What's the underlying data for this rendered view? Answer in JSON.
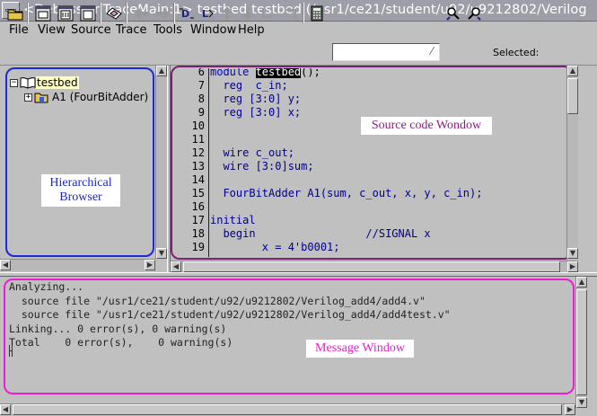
{
  "window": {
    "title": "<Debussy:nTraceMain:1> testbed testbed (/usr1/ce21/student/u92/u9212802/Verilog"
  },
  "menubar": {
    "items": [
      "File",
      "View",
      "Source",
      "Trace",
      "Tools",
      "Window",
      "Help"
    ]
  },
  "toolbar": {
    "icons": [
      "open-folder-icon",
      "schematic-view-icon",
      "waveform-view-icon",
      "state-view-icon",
      "find-icon",
      "back-arrow-icon",
      "forward-arrow-icon",
      "driver-icon",
      "load-icon",
      "up-arrow-icon",
      "down-arrow-icon",
      "trace-back-icon",
      "trace-forward-icon",
      "calculator-icon",
      "search-forward-icon",
      "search-backward-icon"
    ],
    "search_value": "",
    "selected_label": "Selected:"
  },
  "hierarchy": {
    "items": [
      {
        "label": "testbed",
        "toggle": "−",
        "selected": true
      },
      {
        "label": "A1 (FourBitAdder)",
        "toggle": "+",
        "selected": false
      }
    ]
  },
  "source": {
    "lines": [
      {
        "num": "6",
        "code": "module testbed();"
      },
      {
        "num": "7",
        "code": "  reg  c_in;"
      },
      {
        "num": "8",
        "code": "  reg [3:0] y;"
      },
      {
        "num": "9",
        "code": "  reg [3:0] x;"
      },
      {
        "num": "10",
        "code": ""
      },
      {
        "num": "11",
        "code": ""
      },
      {
        "num": "12",
        "code": "  wire c_out;"
      },
      {
        "num": "13",
        "code": "  wire [3:0]sum;"
      },
      {
        "num": "14",
        "code": ""
      },
      {
        "num": "15",
        "code": "  FourBitAdder A1(sum, c_out, x, y, c_in);"
      },
      {
        "num": "16",
        "code": ""
      },
      {
        "num": "17",
        "code": "initial"
      },
      {
        "num": "18",
        "code": "  begin                 //SIGNAL x"
      },
      {
        "num": "19",
        "code": "        x = 4'b0001;"
      }
    ]
  },
  "messages": {
    "lines": [
      "Analyzing...",
      "  source file \"/usr1/ce21/student/u92/u9212802/Verilog_add4/add4.v\"",
      "  source file \"/usr1/ce21/student/u92/u9212802/Verilog_add4/add4test.v\"",
      "Linking... 0 error(s), 0 warning(s)",
      "Total    0 error(s),    0 warning(s)"
    ]
  },
  "annotations": {
    "hierarchical": "Hierarchical\nBrowser",
    "source": "Source code Wondow",
    "message": "Message Window"
  },
  "colors": {
    "hierarchy_frame": "#1d29d6",
    "source_frame": "#7a1f77",
    "message_frame": "#ec1cd7",
    "keyword": "#0000cc"
  }
}
